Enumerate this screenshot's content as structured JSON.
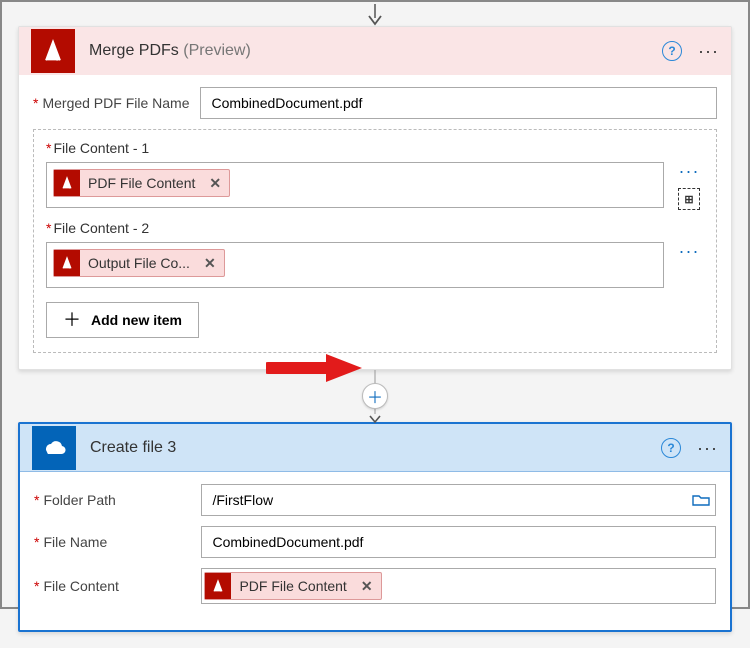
{
  "cardA": {
    "title": "Merge PDFs",
    "preview": "(Preview)",
    "field_merged_name_label": "Merged PDF File Name",
    "field_merged_name_value": "CombinedDocument.pdf",
    "file_contents": [
      {
        "label": "File Content - 1",
        "token_text": "PDF File Content"
      },
      {
        "label": "File Content - 2",
        "token_text": "Output File Co..."
      }
    ],
    "add_item_label": "Add new item"
  },
  "cardB": {
    "title": "Create file 3",
    "fields": {
      "folder_path_label": "Folder Path",
      "folder_path_value": "/FirstFlow",
      "file_name_label": "File Name",
      "file_name_value": "CombinedDocument.pdf",
      "file_content_label": "File Content",
      "file_content_token": "PDF File Content"
    }
  }
}
